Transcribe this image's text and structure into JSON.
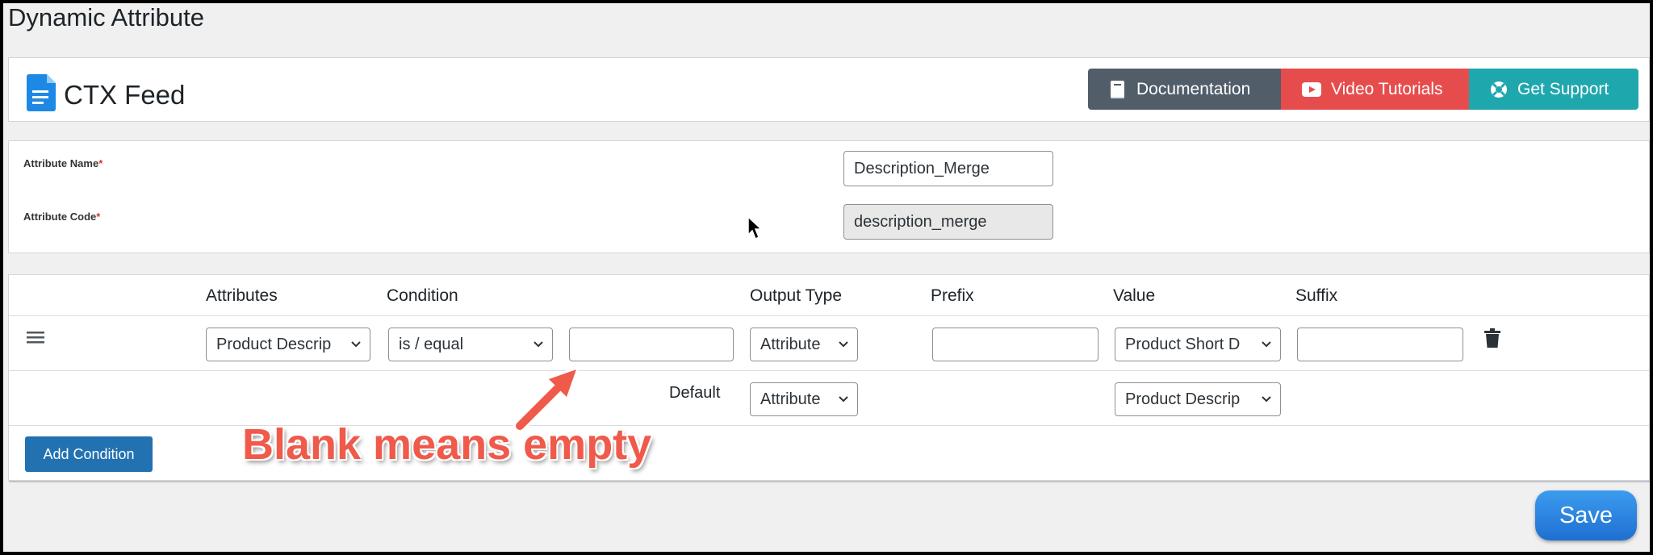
{
  "page": {
    "title": "Dynamic Attribute"
  },
  "header": {
    "brand": "CTX Feed",
    "buttons": {
      "documentation": "Documentation",
      "video": "Video Tutorials",
      "support": "Get Support"
    }
  },
  "attribute_form": {
    "name_label": "Attribute Name",
    "name_value": "Description_Merge",
    "code_label": "Attribute Code",
    "code_value": "description_merge",
    "required_mark": "*"
  },
  "conditions": {
    "headers": {
      "attributes": "Attributes",
      "condition": "Condition",
      "output_type": "Output Type",
      "prefix": "Prefix",
      "value": "Value",
      "suffix": "Suffix"
    },
    "row": {
      "attribute": "Product Descrip",
      "condition": "is / equal",
      "condition_value": "",
      "output_type": "Attribute",
      "prefix": "",
      "value": "Product Short D",
      "suffix": ""
    },
    "default_row": {
      "label": "Default",
      "output_type": "Attribute",
      "value": "Product Descrip"
    },
    "add_button": "Add Condition"
  },
  "save_button": "Save",
  "annotation": {
    "text": "Blank means empty"
  },
  "colors": {
    "documentation": "#525d6a",
    "video": "#e74c4c",
    "support": "#1fa7ae",
    "primary": "#2271b1",
    "annotation": "#ef5a4b"
  }
}
